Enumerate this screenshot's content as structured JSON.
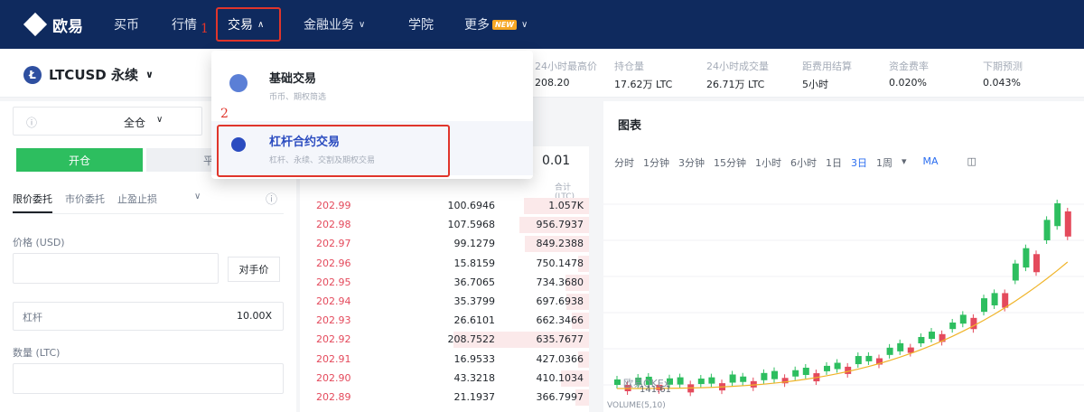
{
  "nav": {
    "logo_text": "欧易",
    "items": [
      "买币",
      "行情",
      "交易",
      "金融业务",
      "学院",
      "更多"
    ],
    "hot_badge": "NEW"
  },
  "annotations": [
    "1",
    "2"
  ],
  "ticker": {
    "symbol": "LTCUSD 永续",
    "stats": [
      {
        "label": "24小时最高价",
        "value": "208.20"
      },
      {
        "label": "持仓量",
        "value": "17.62万 LTC"
      },
      {
        "label": "24小时成交量",
        "value": "26.71万 LTC"
      },
      {
        "label": "距费用结算",
        "value": "5小时"
      },
      {
        "label": "资金费率",
        "value": "0.020%"
      },
      {
        "label": "下期预测",
        "value": "0.043%"
      }
    ]
  },
  "order_panel": {
    "margin_mode": "全仓",
    "open_label": "开仓",
    "close_label": "平仓",
    "tabs": [
      "限价委托",
      "市价委托",
      "止盈止损"
    ],
    "price_label": "价格 (USD)",
    "counterparty_label": "对手价",
    "leverage_label": "杠杆",
    "leverage_value": "10.00X",
    "qty_label": "数量 (LTC)"
  },
  "order_book": {
    "precision": "0.01",
    "col_total": "合计(LTC)",
    "rows": [
      {
        "price": "202.99",
        "size": "100.6946",
        "total": "1.057K"
      },
      {
        "price": "202.98",
        "size": "107.5968",
        "total": "956.7937"
      },
      {
        "price": "202.97",
        "size": "99.1279",
        "total": "849.2388"
      },
      {
        "price": "202.96",
        "size": "15.8159",
        "total": "750.1478"
      },
      {
        "price": "202.95",
        "size": "36.7065",
        "total": "734.3680"
      },
      {
        "price": "202.94",
        "size": "35.3799",
        "total": "697.6938"
      },
      {
        "price": "202.93",
        "size": "26.6101",
        "total": "662.3466"
      },
      {
        "price": "202.92",
        "size": "208.7522",
        "total": "635.7677"
      },
      {
        "price": "202.91",
        "size": "16.9533",
        "total": "427.0366"
      },
      {
        "price": "202.90",
        "size": "43.3218",
        "total": "410.1034"
      },
      {
        "price": "202.89",
        "size": "21.1937",
        "total": "366.7997"
      }
    ]
  },
  "chart": {
    "title": "图表",
    "intervals": [
      "分时",
      "1分钟",
      "3分钟",
      "15分钟",
      "1小时",
      "6小时",
      "1日",
      "3日",
      "1周"
    ],
    "active_interval": "3日",
    "indicator": "MA",
    "watermark": "欧易OKEx",
    "price_marker": "141.61",
    "volume_label": "VOLUME(5,10)"
  },
  "dropdown": {
    "items": [
      {
        "title": "基础交易",
        "desc": "币币、期权简选"
      },
      {
        "title": "杠杆合约交易",
        "desc": "杠杆、永续、交割及期权交易"
      }
    ]
  }
}
